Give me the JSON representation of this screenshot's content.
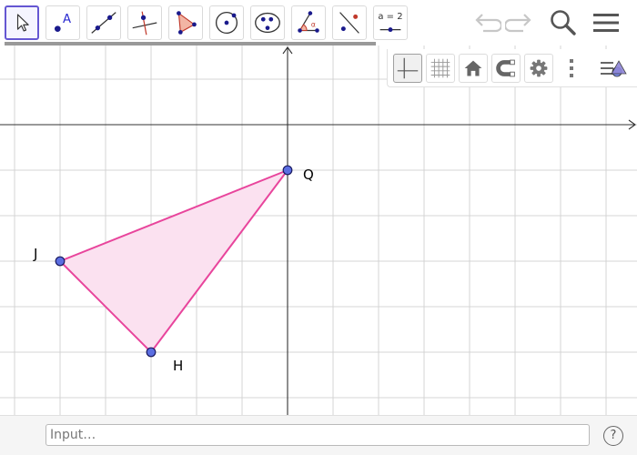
{
  "toolbar": {
    "tools": [
      {
        "name": "move-tool"
      },
      {
        "name": "point-tool",
        "glyph": "A"
      },
      {
        "name": "line-tool"
      },
      {
        "name": "perpendicular-line-tool"
      },
      {
        "name": "polygon-tool"
      },
      {
        "name": "circle-tool"
      },
      {
        "name": "conic-tool"
      },
      {
        "name": "angle-tool",
        "glyph": "α"
      },
      {
        "name": "reflect-tool"
      },
      {
        "name": "slider-tool",
        "glyph": "a = 2"
      }
    ],
    "undo_icon": "undo-icon",
    "redo_icon": "redo-icon",
    "search_icon": "search-icon",
    "menu_icon": "menu-icon"
  },
  "stylebar": {
    "buttons": [
      "axes-toggle",
      "grid-toggle",
      "home-icon",
      "point-capture-icon",
      "gear-icon",
      "more-vertical-icon",
      "view-menu-icon"
    ]
  },
  "graphics": {
    "colors": {
      "grid": "#d4d4d4",
      "axis": "#333333",
      "polygon_stroke": "#e8459c",
      "polygon_fill": "#fbe1f0",
      "point_fill": "#5b6ee1",
      "point_stroke": "#1a1a60"
    },
    "points": [
      {
        "label": "Q"
      },
      {
        "label": "J"
      },
      {
        "label": "H"
      }
    ]
  },
  "inputbar": {
    "placeholder": "Input…",
    "help_label": "?"
  }
}
